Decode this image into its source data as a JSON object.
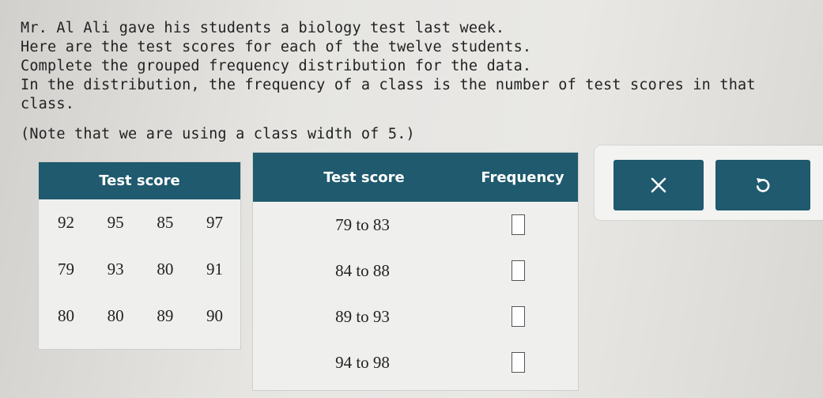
{
  "question": {
    "lines": [
      "Mr. Al Ali gave his students a biology test last week.",
      "Here are the test scores for each of the twelve students.",
      "Complete the grouped frequency distribution for the data.",
      "In the distribution, the frequency of a class is the number of test scores in that class."
    ],
    "note": "(Note that we are using a class width of 5.)"
  },
  "data_table": {
    "header": "Test score",
    "rows": [
      [
        "92",
        "95",
        "85",
        "97"
      ],
      [
        "79",
        "93",
        "80",
        "91"
      ],
      [
        "80",
        "80",
        "89",
        "90"
      ]
    ]
  },
  "frequency_table": {
    "headers": [
      "Test score",
      "Frequency"
    ],
    "classes": [
      "79 to 83",
      "84 to 88",
      "89 to 93",
      "94 to 98"
    ],
    "frequencies": [
      "",
      "",
      "",
      ""
    ]
  },
  "actions": {
    "clear_icon": "x-icon",
    "undo_icon": "undo-icon"
  },
  "colors": {
    "accent": "#1f5a6e"
  }
}
